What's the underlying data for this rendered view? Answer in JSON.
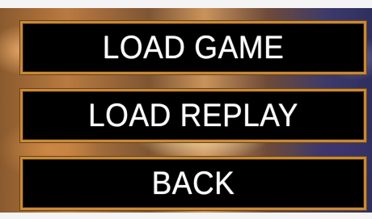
{
  "menu": {
    "buttons": [
      {
        "label": "LOAD GAME"
      },
      {
        "label": "LOAD REPLAY"
      },
      {
        "label": "BACK"
      }
    ]
  },
  "colors": {
    "button_background": "#000000",
    "button_border": "#c88a36",
    "button_text": "#ffffff"
  }
}
